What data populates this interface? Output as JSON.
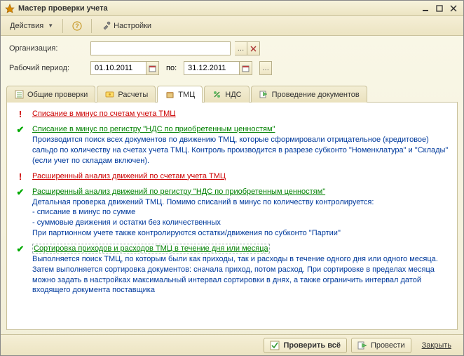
{
  "window": {
    "title": "Мастер проверки учета"
  },
  "toolbar": {
    "actions": "Действия",
    "settings": "Настройки"
  },
  "form": {
    "org_label": "Организация:",
    "org_value": "",
    "period_label": "Рабочий период:",
    "date_from": "01.10.2011",
    "date_to_label": "по:",
    "date_to": "31.12.2011"
  },
  "tabs": [
    {
      "label": "Общие проверки"
    },
    {
      "label": "Расчеты"
    },
    {
      "label": "ТМЦ"
    },
    {
      "label": "НДС"
    },
    {
      "label": "Проведение документов"
    }
  ],
  "active_tab": "ТМЦ",
  "checks": [
    {
      "status": "err",
      "title": "Списание в минус по счетам учета ТМЦ",
      "desc": null
    },
    {
      "status": "ok",
      "title": "Списание в минус по регистру \"НДС по приобретенным ценностям\"",
      "desc": "Производится поиск всех документов по движению ТМЦ, которые сформировали отрицательное (кредитовое) сальдо по количеству на счетах учета ТМЦ. Контроль производится в разрезе субконто \"Номенклатура\" и \"Склады\" (если учет по складам включен)."
    },
    {
      "status": "err",
      "title": "Расширенный анализ движений по счетам учета ТМЦ",
      "desc": null
    },
    {
      "status": "ok",
      "title": "Расширенный анализ движений по регистру \"НДС по приобретенным ценностям\"",
      "desc": "Детальная проверка движений ТМЦ. Помимо списаний в минус по количеству контролируется:\n- списание в минус по сумме\n- суммовые движения и остатки без количественных\nПри партионном учете также контролируются остатки/движения по субконто \"Партии\""
    },
    {
      "status": "ok",
      "title": "Сортировка приходов и расходов ТМЦ в течение дня или месяца",
      "desc": "Выполняется поиск ТМЦ, по которым были как приходы, так и расходы в течение одного дня или одного месяца. Затем выполняется сортировка документов: сначала приход, потом расход. При сортировке в пределах месяца можно задать в настройках максимальный интервал сортировки в днях, а также ограничить интервал датой входящего документа поставщика",
      "dashed": true
    }
  ],
  "footer": {
    "check_all": "Проверить всё",
    "post": "Провести",
    "close": "Закрыть"
  }
}
